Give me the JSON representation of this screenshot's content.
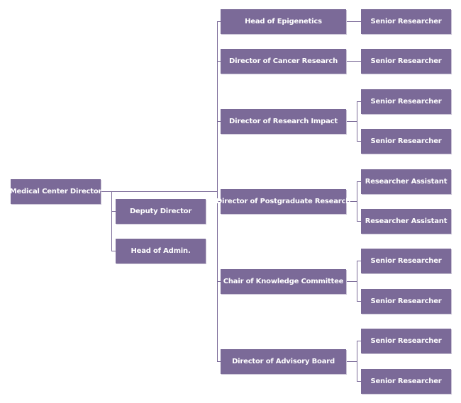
{
  "colors": {
    "box": "#7b6a98",
    "line": "#7b6a98",
    "text": "#ffffff"
  },
  "root": {
    "label": "Medical Center Director"
  },
  "assistants": [
    {
      "label": "Deputy Director"
    },
    {
      "label": "Head of Admin."
    }
  ],
  "departments": [
    {
      "label": "Head of Epigenetics",
      "children": [
        {
          "label": "Senior Researcher"
        }
      ]
    },
    {
      "label": "Director of Cancer Research",
      "children": [
        {
          "label": "Senior Researcher"
        }
      ]
    },
    {
      "label": "Director of Research Impact",
      "children": [
        {
          "label": "Senior Researcher"
        },
        {
          "label": "Senior Researcher"
        }
      ]
    },
    {
      "label": "Director of Postgraduate Research",
      "children": [
        {
          "label": "Researcher Assistant"
        },
        {
          "label": "Researcher Assistant"
        }
      ]
    },
    {
      "label": "Chair of Knowledge Committee",
      "children": [
        {
          "label": "Senior Researcher"
        },
        {
          "label": "Senior Researcher"
        }
      ]
    },
    {
      "label": "Director of Advisory Board",
      "children": [
        {
          "label": "Senior Researcher"
        },
        {
          "label": "Senior Researcher"
        }
      ]
    }
  ]
}
